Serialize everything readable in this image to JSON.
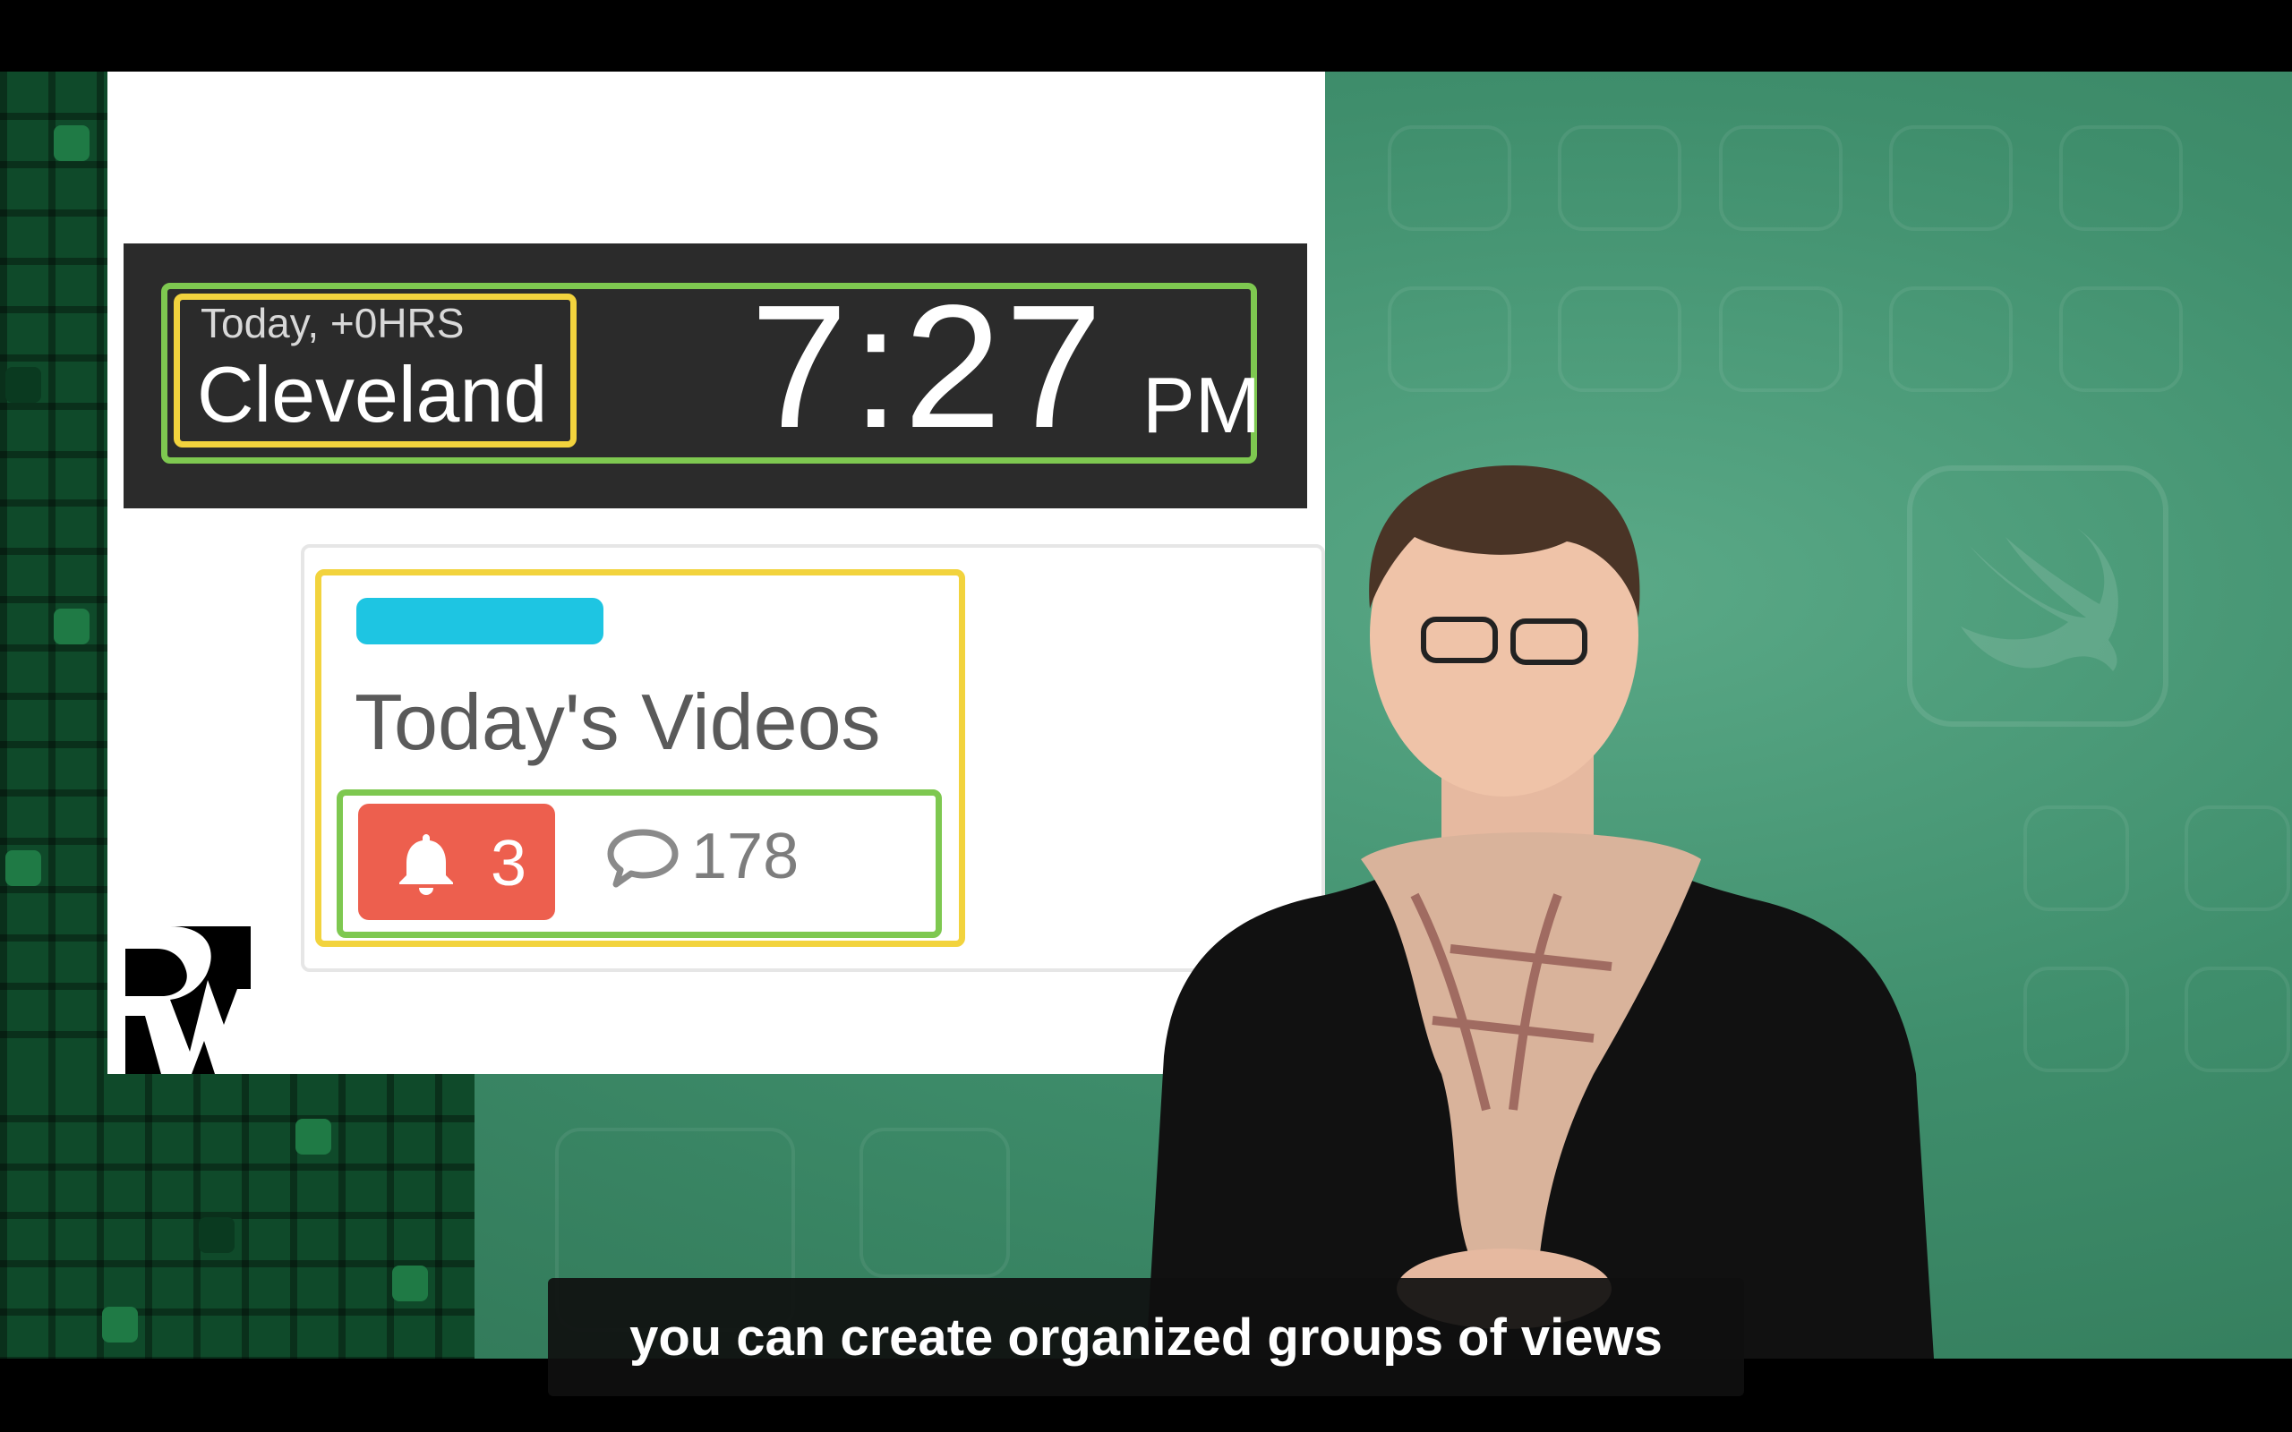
{
  "clock": {
    "timezone_label": "Today, +0HRS",
    "city": "Cleveland",
    "time": "7:27",
    "ampm": "PM"
  },
  "card": {
    "title": "Today's Videos",
    "notification_count": "3",
    "comment_count": "178",
    "accent_color": "#1ec5e2",
    "badge_color": "#ed5f4e"
  },
  "annotations": {
    "green_outline_color": "#7ec850",
    "yellow_outline_color": "#f2d33d"
  },
  "icons": [
    "bell-icon",
    "comment-icon",
    "rw-logo",
    "swift-icon"
  ],
  "caption": {
    "text": "you can create organized groups of views"
  }
}
